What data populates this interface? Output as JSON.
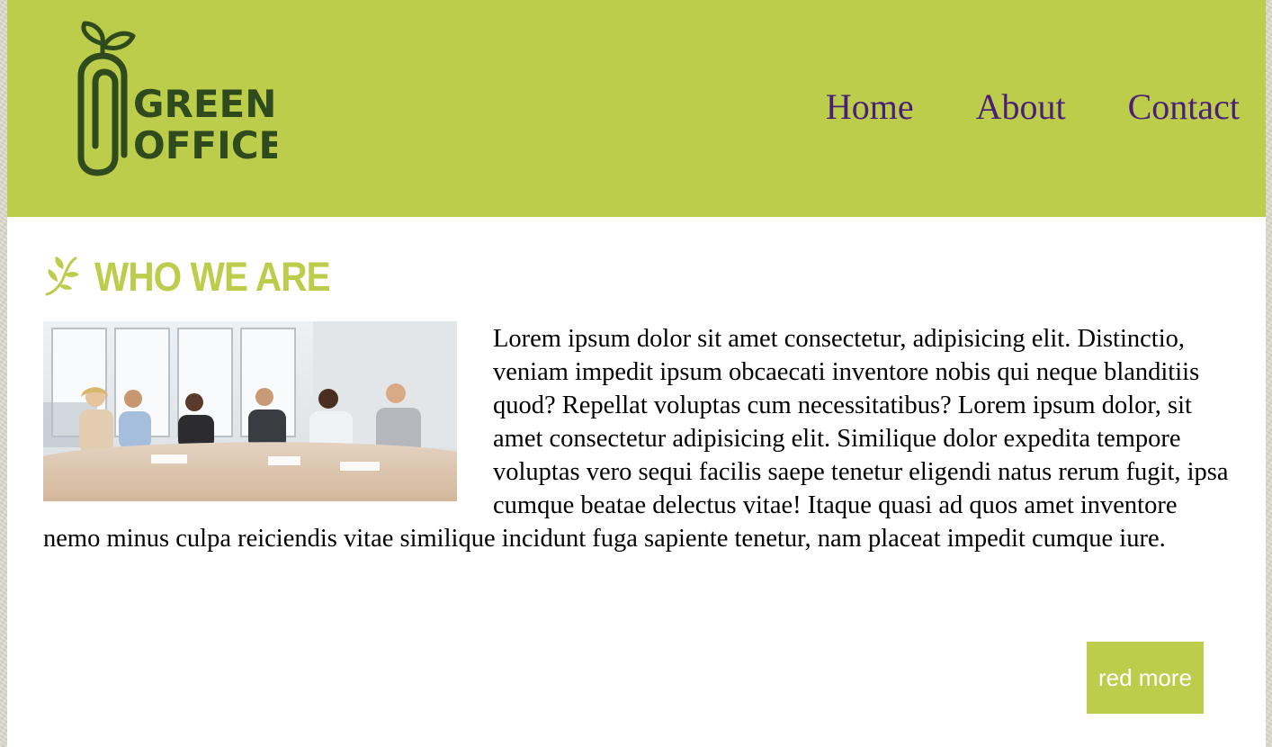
{
  "brand": {
    "logo_line1": "GREEN",
    "logo_line2": "OFFICE",
    "color": "#bccc4b",
    "logo_color": "#2f4a1c"
  },
  "nav": {
    "items": [
      {
        "label": "Home"
      },
      {
        "label": "About"
      },
      {
        "label": "Contact"
      }
    ],
    "link_color": "#4b1f78"
  },
  "section": {
    "icon": "leaf-icon",
    "title": "WHO WE ARE",
    "image_alt": "team-meeting-photo",
    "body": "Lorem ipsum dolor sit amet consectetur, adipisicing elit. Distinctio, veniam impedit ipsum obcaecati inventore nobis qui neque blanditiis quod? Repellat voluptas cum necessitatibus? Lorem ipsum dolor, sit amet consectetur adipisicing elit. Similique dolor expedita tempore voluptas vero sequi facilis saepe tenetur eligendi natus rerum fugit, ipsa cumque beatae delectus vitae! Itaque quasi ad quos amet inventore nemo minus culpa reiciendis vitae similique incidunt fuga sapiente tenetur, nam placeat impedit cumque iure.",
    "button_label": "red more"
  }
}
